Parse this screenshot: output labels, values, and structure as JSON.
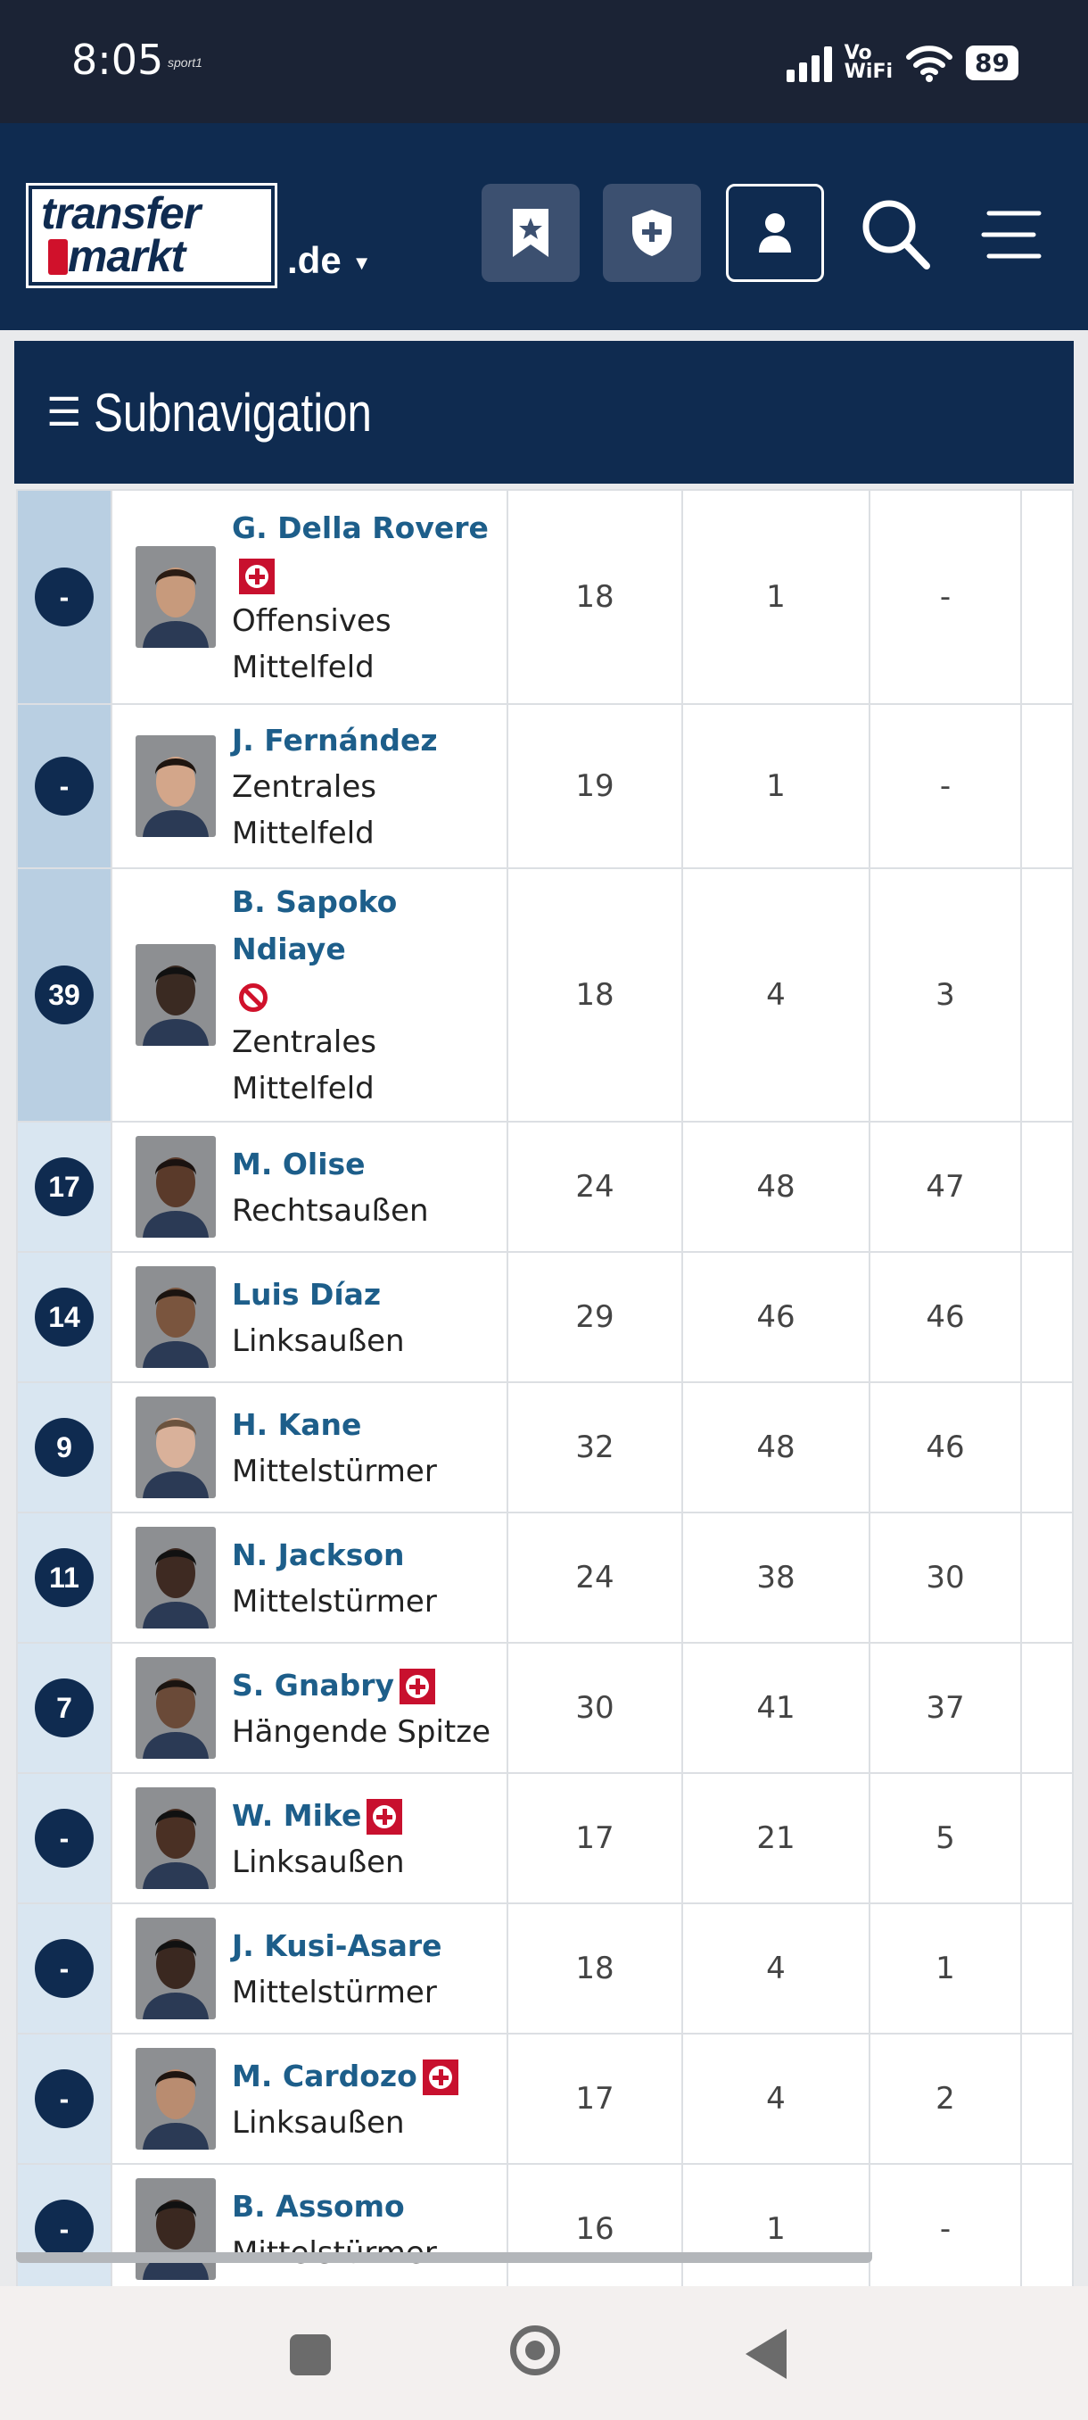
{
  "status": {
    "time": "8:05",
    "app_badge": "sport1",
    "network": "Vo WiFi",
    "battery": "89"
  },
  "header": {
    "logo_line1": "transfer",
    "logo_line2": "markt",
    "tld": ".de"
  },
  "subnav": {
    "label": "Subnavigation"
  },
  "players": [
    {
      "num": "-",
      "name": "G. Della Rovere",
      "badge": "injury",
      "pos_line1": "Offensives",
      "pos_line2": "Mittelfeld",
      "age": "18",
      "a": "1",
      "b": "-",
      "band": "dark",
      "skin": "#c79a7c",
      "hair": "#2a1c14"
    },
    {
      "num": "-",
      "name": "J. Fernández",
      "badge": "",
      "pos_line1": "Zentrales",
      "pos_line2": "Mittelfeld",
      "age": "19",
      "a": "1",
      "b": "-",
      "band": "dark",
      "skin": "#d3a68a",
      "hair": "#1e1510"
    },
    {
      "num": "39",
      "name": "B. Sapoko Ndiaye",
      "badge": "ban",
      "pos_line1": "Zentrales",
      "pos_line2": "Mittelfeld",
      "age": "18",
      "a": "4",
      "b": "3",
      "band": "dark",
      "skin": "#3a2a22",
      "hair": "#111"
    },
    {
      "num": "17",
      "name": "M. Olise",
      "badge": "",
      "pos_line1": "Rechtsaußen",
      "pos_line2": "",
      "age": "24",
      "a": "48",
      "b": "47",
      "band": "light",
      "skin": "#5a3a2a",
      "hair": "#1a1210"
    },
    {
      "num": "14",
      "name": "Luis Díaz",
      "badge": "",
      "pos_line1": "Linksaußen",
      "pos_line2": "",
      "age": "29",
      "a": "46",
      "b": "46",
      "band": "light",
      "skin": "#7a553e",
      "hair": "#1b1410"
    },
    {
      "num": "9",
      "name": "H. Kane",
      "badge": "",
      "pos_line1": "Mittelstürmer",
      "pos_line2": "",
      "age": "32",
      "a": "48",
      "b": "46",
      "band": "light",
      "skin": "#d9b19a",
      "hair": "#6b533e"
    },
    {
      "num": "11",
      "name": "N. Jackson",
      "badge": "",
      "pos_line1": "Mittelstürmer",
      "pos_line2": "",
      "age": "24",
      "a": "38",
      "b": "30",
      "band": "light",
      "skin": "#3e2a22",
      "hair": "#111"
    },
    {
      "num": "7",
      "name": "S. Gnabry",
      "badge": "injury",
      "pos_line1": "Hängende Spitze",
      "pos_line2": "",
      "age": "30",
      "a": "41",
      "b": "37",
      "band": "light",
      "skin": "#6a4a38",
      "hair": "#1a1410"
    },
    {
      "num": "-",
      "name": "W. Mike",
      "badge": "injury",
      "pos_line1": "Linksaußen",
      "pos_line2": "",
      "age": "17",
      "a": "21",
      "b": "5",
      "band": "light",
      "skin": "#4a3024",
      "hair": "#111"
    },
    {
      "num": "-",
      "name": "J. Kusi-Asare",
      "badge": "",
      "pos_line1": "Mittelstürmer",
      "pos_line2": "",
      "age": "18",
      "a": "4",
      "b": "1",
      "band": "light",
      "skin": "#3a2820",
      "hair": "#111"
    },
    {
      "num": "-",
      "name": "M. Cardozo",
      "badge": "injury",
      "pos_line1": "Linksaußen",
      "pos_line2": "",
      "age": "17",
      "a": "4",
      "b": "2",
      "band": "light",
      "skin": "#b98c70",
      "hair": "#1e1510"
    },
    {
      "num": "-",
      "name": "B. Assomo",
      "badge": "",
      "pos_line1": "Mittelstürmer",
      "pos_line2": "",
      "age": "16",
      "a": "1",
      "b": "-",
      "band": "light",
      "skin": "#3a2820",
      "hair": "#111"
    }
  ]
}
